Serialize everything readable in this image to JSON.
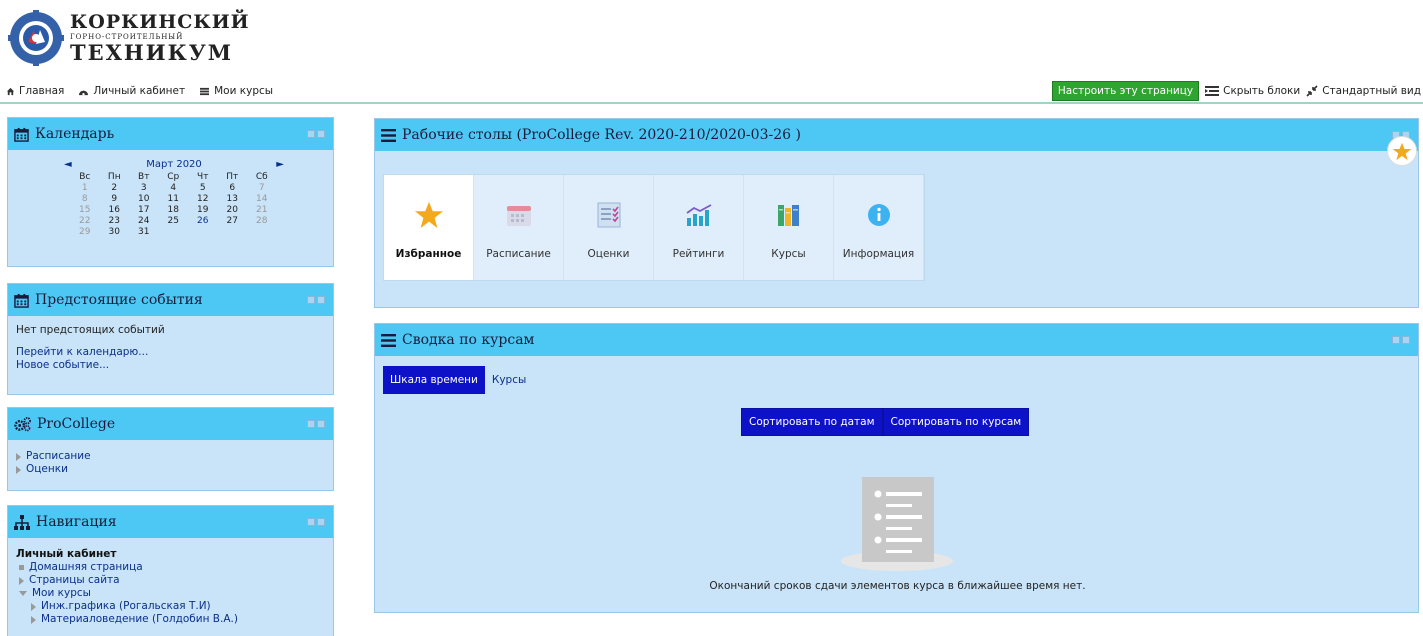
{
  "logo": {
    "line1": "КОРКИНСКИЙ",
    "line2": "ГОРНО-СТРОИТЕЛЬНЫЙ",
    "line3": "ТЕХНИКУМ"
  },
  "nav": {
    "items": [
      {
        "label": "Главная",
        "icon": "home-icon"
      },
      {
        "label": "Личный кабинет",
        "icon": "dashboard-icon"
      },
      {
        "label": "Мои курсы",
        "icon": "courses-icon"
      }
    ],
    "customize_label": "Настроить эту страницу",
    "hide_blocks_label": "Скрыть блоки",
    "standard_view_label": "Стандартный вид"
  },
  "calendar": {
    "title": "Календарь",
    "prev": "◄",
    "next": "►",
    "month": "Март 2020",
    "weekdays": [
      "Вс",
      "Пн",
      "Вт",
      "Ср",
      "Чт",
      "Пт",
      "Сб"
    ],
    "weeks": [
      [
        "1",
        "2",
        "3",
        "4",
        "5",
        "6",
        "7"
      ],
      [
        "8",
        "9",
        "10",
        "11",
        "12",
        "13",
        "14"
      ],
      [
        "15",
        "16",
        "17",
        "18",
        "19",
        "20",
        "21"
      ],
      [
        "22",
        "23",
        "24",
        "25",
        "26",
        "27",
        "28"
      ],
      [
        "29",
        "30",
        "31",
        "",
        "",
        "",
        ""
      ]
    ],
    "today": "26"
  },
  "upcoming": {
    "title": "Предстоящие события",
    "empty": "Нет предстоящих событий",
    "goto_calendar": "Перейти к календарю...",
    "new_event": "Новое событие..."
  },
  "procollege": {
    "title": "ProCollege",
    "items": [
      "Расписание",
      "Оценки"
    ]
  },
  "navigation": {
    "title": "Навигация",
    "root": "Личный кабинет",
    "home": "Домашняя страница",
    "site_pages": "Страницы сайта",
    "my_courses": "Мои курсы",
    "courses": [
      "Инж.графика (Рогальская Т.И)",
      "Материаловедение (Голдобин В.А.)"
    ]
  },
  "dashboard": {
    "title": "Рабочие столы (ProCollege Rev. 2020-210/2020-03-26 )",
    "tiles": [
      {
        "label": "Избранное",
        "icon": "star-icon"
      },
      {
        "label": "Расписание",
        "icon": "calendar-icon"
      },
      {
        "label": "Оценки",
        "icon": "grades-icon"
      },
      {
        "label": "Рейтинги",
        "icon": "ratings-chart-icon"
      },
      {
        "label": "Курсы",
        "icon": "books-icon"
      },
      {
        "label": "Информация",
        "icon": "info-icon"
      }
    ]
  },
  "summary": {
    "title": "Сводка по курсам",
    "tabs": [
      "Шкала времени",
      "Курсы"
    ],
    "sort_by_dates": "Сортировать по датам",
    "sort_by_courses": "Сортировать по курсам",
    "empty": "Окончаний сроков сдачи элементов курса в ближайшее время нет."
  },
  "colors": {
    "block_header": "#4dc8f5",
    "block_body": "#c9e4f8",
    "primary_button": "#0d12c8",
    "green_button": "#2ea52e"
  }
}
